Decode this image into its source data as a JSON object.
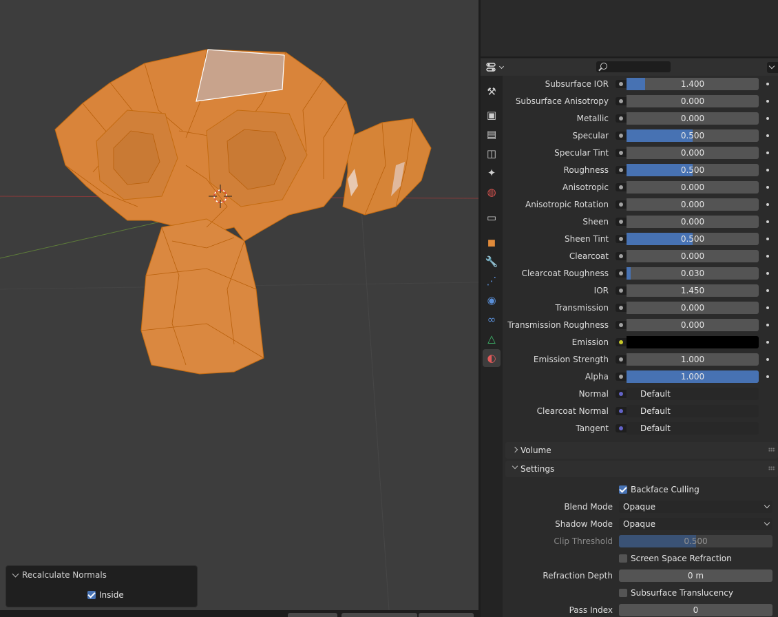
{
  "viewport": {
    "redo_panel": {
      "title": "Recalculate Normals",
      "inside_label": "Inside",
      "inside_checked": true
    }
  },
  "properties": {
    "rows": [
      {
        "label": "Subsurface IOR",
        "value": "1.400",
        "fill": 0.14,
        "socket": "gray"
      },
      {
        "label": "Subsurface Anisotropy",
        "value": "0.000",
        "fill": 0,
        "socket": "gray"
      },
      {
        "label": "Metallic",
        "value": "0.000",
        "fill": 0,
        "socket": "gray"
      },
      {
        "label": "Specular",
        "value": "0.500",
        "fill": 0.5,
        "socket": "gray"
      },
      {
        "label": "Specular Tint",
        "value": "0.000",
        "fill": 0,
        "socket": "gray"
      },
      {
        "label": "Roughness",
        "value": "0.500",
        "fill": 0.5,
        "socket": "gray"
      },
      {
        "label": "Anisotropic",
        "value": "0.000",
        "fill": 0,
        "socket": "gray"
      },
      {
        "label": "Anisotropic Rotation",
        "value": "0.000",
        "fill": 0,
        "socket": "gray"
      },
      {
        "label": "Sheen",
        "value": "0.000",
        "fill": 0,
        "socket": "gray"
      },
      {
        "label": "Sheen Tint",
        "value": "0.500",
        "fill": 0.5,
        "socket": "gray"
      },
      {
        "label": "Clearcoat",
        "value": "0.000",
        "fill": 0,
        "socket": "gray"
      },
      {
        "label": "Clearcoat Roughness",
        "value": "0.030",
        "fill": 0.03,
        "socket": "gray"
      },
      {
        "label": "IOR",
        "value": "1.450",
        "fill": 0,
        "socket": "gray"
      },
      {
        "label": "Transmission",
        "value": "0.000",
        "fill": 0,
        "socket": "gray"
      },
      {
        "label": "Transmission Roughness",
        "value": "0.000",
        "fill": 0,
        "socket": "gray"
      },
      {
        "label": "Emission",
        "value": "",
        "color": "#000000",
        "socket": "yellow"
      },
      {
        "label": "Emission Strength",
        "value": "1.000",
        "fill": 0,
        "socket": "gray"
      },
      {
        "label": "Alpha",
        "value": "1.000",
        "fill": 1,
        "socket": "gray"
      },
      {
        "label": "Normal",
        "value": "Default",
        "socket": "vector"
      },
      {
        "label": "Clearcoat Normal",
        "value": "Default",
        "socket": "vector"
      },
      {
        "label": "Tangent",
        "value": "Default",
        "socket": "vector"
      }
    ],
    "volume_panel": {
      "title": "Volume",
      "expanded": false
    },
    "settings_panel": {
      "title": "Settings",
      "expanded": true,
      "backface_culling": {
        "label": "Backface Culling",
        "checked": true
      },
      "blend_mode": {
        "label": "Blend Mode",
        "value": "Opaque"
      },
      "shadow_mode": {
        "label": "Shadow Mode",
        "value": "Opaque"
      },
      "clip_threshold": {
        "label": "Clip Threshold",
        "value": "0.500",
        "fill": 0.5,
        "enabled": false
      },
      "screen_space_refraction": {
        "label": "Screen Space Refraction",
        "checked": false
      },
      "refraction_depth": {
        "label": "Refraction Depth",
        "value": "0 m"
      },
      "subsurface_translucency": {
        "label": "Subsurface Translucency",
        "checked": false
      },
      "pass_index": {
        "label": "Pass Index",
        "value": "0"
      }
    },
    "tab_icons": [
      "tool-icon",
      "render-icon",
      "output-icon",
      "view-layer-icon",
      "scene-icon",
      "world-icon",
      "collection-icon",
      "object-icon",
      "modifier-icon",
      "particles-icon",
      "physics-icon",
      "constraints-icon",
      "data-icon",
      "material-icon"
    ],
    "active_tab": "material-icon",
    "colors": {
      "accent": "#4772b3",
      "mesh_orange": "#e0892a",
      "viewport_bg": "#3d3d3d"
    }
  }
}
